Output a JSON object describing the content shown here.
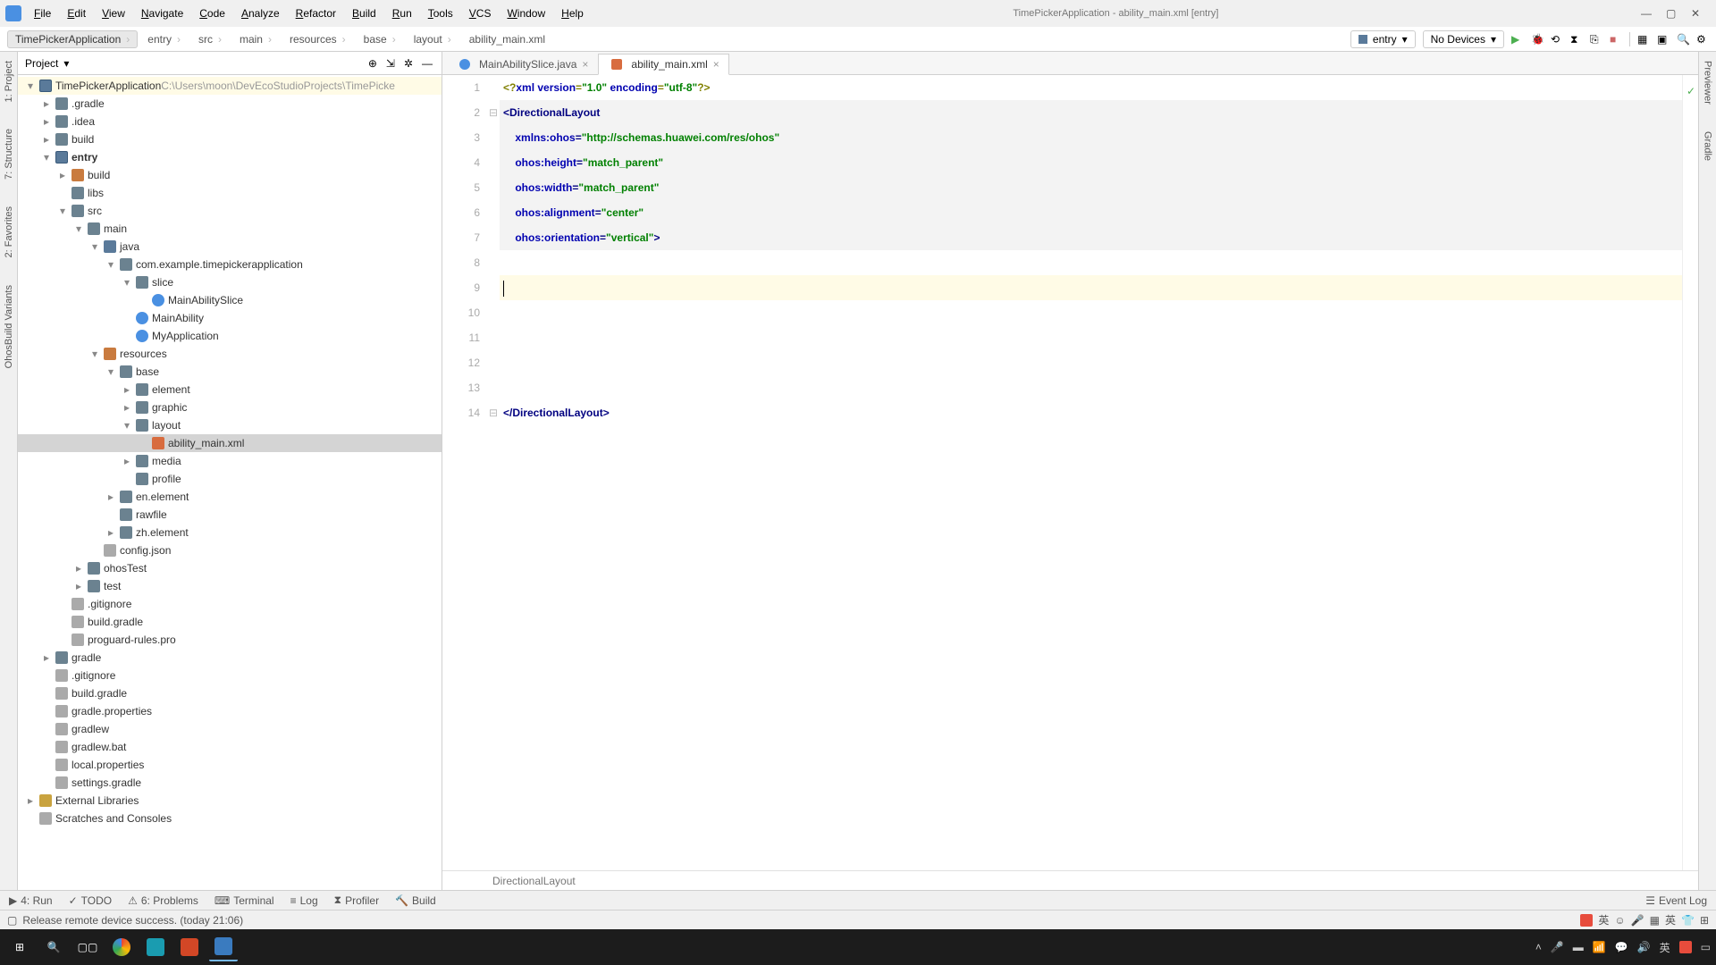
{
  "window": {
    "title": "TimePickerApplication - ability_main.xml [entry]"
  },
  "menubar": [
    "File",
    "Edit",
    "View",
    "Navigate",
    "Code",
    "Analyze",
    "Refactor",
    "Build",
    "Run",
    "Tools",
    "VCS",
    "Window",
    "Help"
  ],
  "breadcrumbs": [
    "TimePickerApplication",
    "entry",
    "src",
    "main",
    "resources",
    "base",
    "layout",
    "ability_main.xml"
  ],
  "run_config": {
    "module": "entry",
    "device": "No Devices"
  },
  "project_panel": {
    "title": "Project",
    "root": {
      "label": "TimePickerApplication",
      "path": "C:\\Users\\moon\\DevEcoStudioProjects\\TimePicke"
    }
  },
  "tree": [
    {
      "d": 0,
      "l": "TimePickerApplication",
      "i": "module",
      "e": true,
      "hl": true,
      "extra": "C:\\Users\\moon\\DevEcoStudioProjects\\TimePicke"
    },
    {
      "d": 1,
      "l": ".gradle",
      "i": "folder",
      "e": false
    },
    {
      "d": 1,
      "l": ".idea",
      "i": "folder",
      "e": false
    },
    {
      "d": 1,
      "l": "build",
      "i": "folder",
      "e": false
    },
    {
      "d": 1,
      "l": "entry",
      "i": "module",
      "e": true,
      "bold": true
    },
    {
      "d": 2,
      "l": "build",
      "i": "folder-res",
      "e": false
    },
    {
      "d": 2,
      "l": "libs",
      "i": "folder",
      "e": false,
      "leaf": true
    },
    {
      "d": 2,
      "l": "src",
      "i": "folder",
      "e": true
    },
    {
      "d": 3,
      "l": "main",
      "i": "folder",
      "e": true
    },
    {
      "d": 4,
      "l": "java",
      "i": "folder-src",
      "e": true
    },
    {
      "d": 5,
      "l": "com.example.timepickerapplication",
      "i": "folder",
      "e": true
    },
    {
      "d": 6,
      "l": "slice",
      "i": "folder",
      "e": true
    },
    {
      "d": 7,
      "l": "MainAbilitySlice",
      "i": "java",
      "leaf": true
    },
    {
      "d": 6,
      "l": "MainAbility",
      "i": "java",
      "leaf": true
    },
    {
      "d": 6,
      "l": "MyApplication",
      "i": "java",
      "leaf": true
    },
    {
      "d": 4,
      "l": "resources",
      "i": "folder-res",
      "e": true
    },
    {
      "d": 5,
      "l": "base",
      "i": "folder",
      "e": true
    },
    {
      "d": 6,
      "l": "element",
      "i": "folder",
      "e": false
    },
    {
      "d": 6,
      "l": "graphic",
      "i": "folder",
      "e": false
    },
    {
      "d": 6,
      "l": "layout",
      "i": "folder",
      "e": true
    },
    {
      "d": 7,
      "l": "ability_main.xml",
      "i": "xml",
      "leaf": true,
      "sel": true
    },
    {
      "d": 6,
      "l": "media",
      "i": "folder",
      "e": false
    },
    {
      "d": 6,
      "l": "profile",
      "i": "folder",
      "e": false,
      "leaf": true
    },
    {
      "d": 5,
      "l": "en.element",
      "i": "folder",
      "e": false
    },
    {
      "d": 5,
      "l": "rawfile",
      "i": "folder",
      "e": false,
      "leaf": true
    },
    {
      "d": 5,
      "l": "zh.element",
      "i": "folder",
      "e": false
    },
    {
      "d": 4,
      "l": "config.json",
      "i": "file",
      "leaf": true
    },
    {
      "d": 3,
      "l": "ohosTest",
      "i": "folder",
      "e": false
    },
    {
      "d": 3,
      "l": "test",
      "i": "folder",
      "e": false
    },
    {
      "d": 2,
      "l": ".gitignore",
      "i": "file",
      "leaf": true
    },
    {
      "d": 2,
      "l": "build.gradle",
      "i": "file",
      "leaf": true
    },
    {
      "d": 2,
      "l": "proguard-rules.pro",
      "i": "file",
      "leaf": true
    },
    {
      "d": 1,
      "l": "gradle",
      "i": "folder",
      "e": false
    },
    {
      "d": 1,
      "l": ".gitignore",
      "i": "file",
      "leaf": true
    },
    {
      "d": 1,
      "l": "build.gradle",
      "i": "file",
      "leaf": true
    },
    {
      "d": 1,
      "l": "gradle.properties",
      "i": "file",
      "leaf": true
    },
    {
      "d": 1,
      "l": "gradlew",
      "i": "file",
      "leaf": true
    },
    {
      "d": 1,
      "l": "gradlew.bat",
      "i": "file",
      "leaf": true
    },
    {
      "d": 1,
      "l": "local.properties",
      "i": "file",
      "leaf": true
    },
    {
      "d": 1,
      "l": "settings.gradle",
      "i": "file",
      "leaf": true
    },
    {
      "d": 0,
      "l": "External Libraries",
      "i": "lib",
      "e": false
    },
    {
      "d": 0,
      "l": "Scratches and Consoles",
      "i": "file",
      "e": false,
      "leaf": true
    }
  ],
  "editor_tabs": [
    {
      "label": "MainAbilitySlice.java",
      "icon": "java",
      "active": false
    },
    {
      "label": "ability_main.xml",
      "icon": "xml",
      "active": true
    }
  ],
  "code_lines": 14,
  "current_line": 9,
  "highlight_block": {
    "from": 2,
    "to": 7
  },
  "code_tokens": [
    [
      [
        "decl",
        "<?"
      ],
      [
        "attr",
        "xml version"
      ],
      [
        "decl",
        "="
      ],
      [
        "str",
        "\"1.0\""
      ],
      [
        "decl",
        " "
      ],
      [
        "attr",
        "encoding"
      ],
      [
        "decl",
        "="
      ],
      [
        "str",
        "\"utf-8\""
      ],
      [
        "decl",
        "?>"
      ]
    ],
    [
      [
        "tag",
        "<DirectionalLayout"
      ]
    ],
    [
      [
        "txt",
        "    "
      ],
      [
        "attr",
        "xmlns:ohos"
      ],
      [
        "tag",
        "="
      ],
      [
        "str",
        "\"http://schemas.huawei.com/res/ohos\""
      ]
    ],
    [
      [
        "txt",
        "    "
      ],
      [
        "attr",
        "ohos:height"
      ],
      [
        "tag",
        "="
      ],
      [
        "str",
        "\"match_parent\""
      ]
    ],
    [
      [
        "txt",
        "    "
      ],
      [
        "attr",
        "ohos:width"
      ],
      [
        "tag",
        "="
      ],
      [
        "str",
        "\"match_parent\""
      ]
    ],
    [
      [
        "txt",
        "    "
      ],
      [
        "attr",
        "ohos:alignment"
      ],
      [
        "tag",
        "="
      ],
      [
        "str",
        "\"center\""
      ]
    ],
    [
      [
        "txt",
        "    "
      ],
      [
        "attr",
        "ohos:orientation"
      ],
      [
        "tag",
        "="
      ],
      [
        "str",
        "\"vertical\""
      ],
      [
        "tag",
        ">"
      ]
    ],
    [],
    [],
    [],
    [],
    [],
    [],
    [
      [
        "tag",
        "</DirectionalLayout>"
      ]
    ]
  ],
  "editor_breadcrumb": "DirectionalLayout",
  "bottom_tabs": [
    "4: Run",
    "TODO",
    "6: Problems",
    "Terminal",
    "Log",
    "Profiler",
    "Build"
  ],
  "event_log_label": "Event Log",
  "status_message": "Release remote device success. (today 21:06)",
  "left_tool_tabs": [
    "1: Project",
    "7: Structure",
    "2: Favorites",
    "OhosBuild Variants"
  ],
  "right_tool_tabs": [
    "Previewer",
    "Gradle"
  ]
}
